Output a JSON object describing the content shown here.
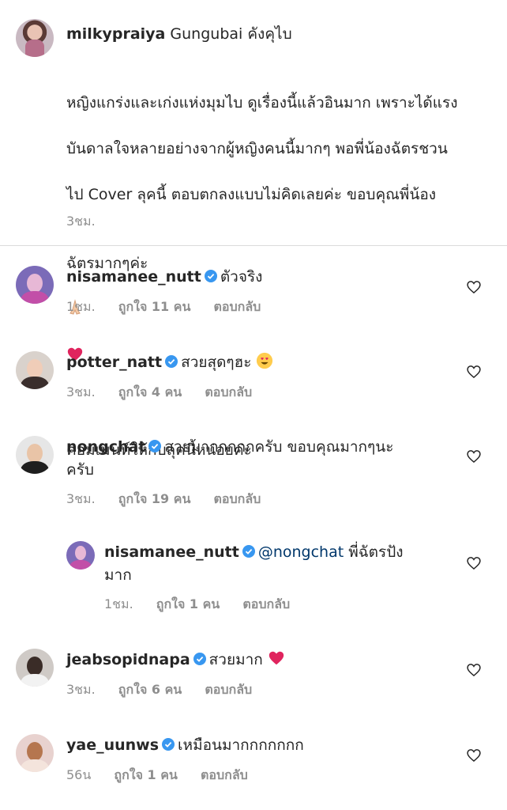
{
  "caption": {
    "username": "milkypraiya",
    "text": "Gungubai คังคุไบ",
    "body_lines": [
      "หญิงแกร่งและเก่งแห่งมุมไบ ดูเรื่องนี้แล้วอินมาก เพราะได้แรง",
      "บันดาลใจหลายอย่างจากผู้หญิงคนนี้มากๆ พอพี่น้องฉัตรชวน",
      "ไป Cover ลุคนี้ ตอบตกลงแบบไม่คิดเลยค่ะ ขอบคุณพี่น้อง",
      "ฉัตรมากๆค่ะ",
      "",
      "คอมเมนท์ให้กับลุคนี้หน่อยค่ะ"
    ],
    "time": "3ชม."
  },
  "comments": [
    {
      "username": "nisamanee_nutt",
      "text": "ตัวจริง",
      "time": "1ชม.",
      "likes": "ถูกใจ 11 คน",
      "reply": "ตอบกลับ"
    },
    {
      "username": "potter_natt",
      "text": "สวยสุดๆฮะ",
      "time": "3ชม.",
      "likes": "ถูกใจ 4 คน",
      "reply": "ตอบกลับ"
    },
    {
      "username": "nongchat",
      "text": "สวยมากกกกกครับ ขอบคุณมากๆนะ",
      "text2": "ครับ",
      "time": "3ชม.",
      "likes": "ถูกใจ 19 คน",
      "reply": "ตอบกลับ"
    },
    {
      "username": "nisamanee_nutt",
      "mention": "@nongchat",
      "text": "พี่ฉัตรปัง",
      "text2": "มาก",
      "time": "1ชม.",
      "likes": "ถูกใจ 1 คน",
      "reply": "ตอบกลับ"
    },
    {
      "username": "jeabsopidnapa",
      "text": "สวยมาก",
      "time": "3ชม.",
      "likes": "ถูกใจ 6 คน",
      "reply": "ตอบกลับ"
    },
    {
      "username": "yae_uunws",
      "text": "เหมือนมากกกกกกก",
      "time": "56น",
      "likes": "ถูกใจ 1 คน",
      "reply": "ตอบกลับ"
    }
  ],
  "icons": {
    "verified": "verified-badge-icon",
    "like": "heart-outline-icon"
  },
  "colors": {
    "text": "#262626",
    "secondary": "#8e8e8e",
    "verified": "#3897f0",
    "mention": "#00376b",
    "heart_emoji": "#e0245e"
  }
}
